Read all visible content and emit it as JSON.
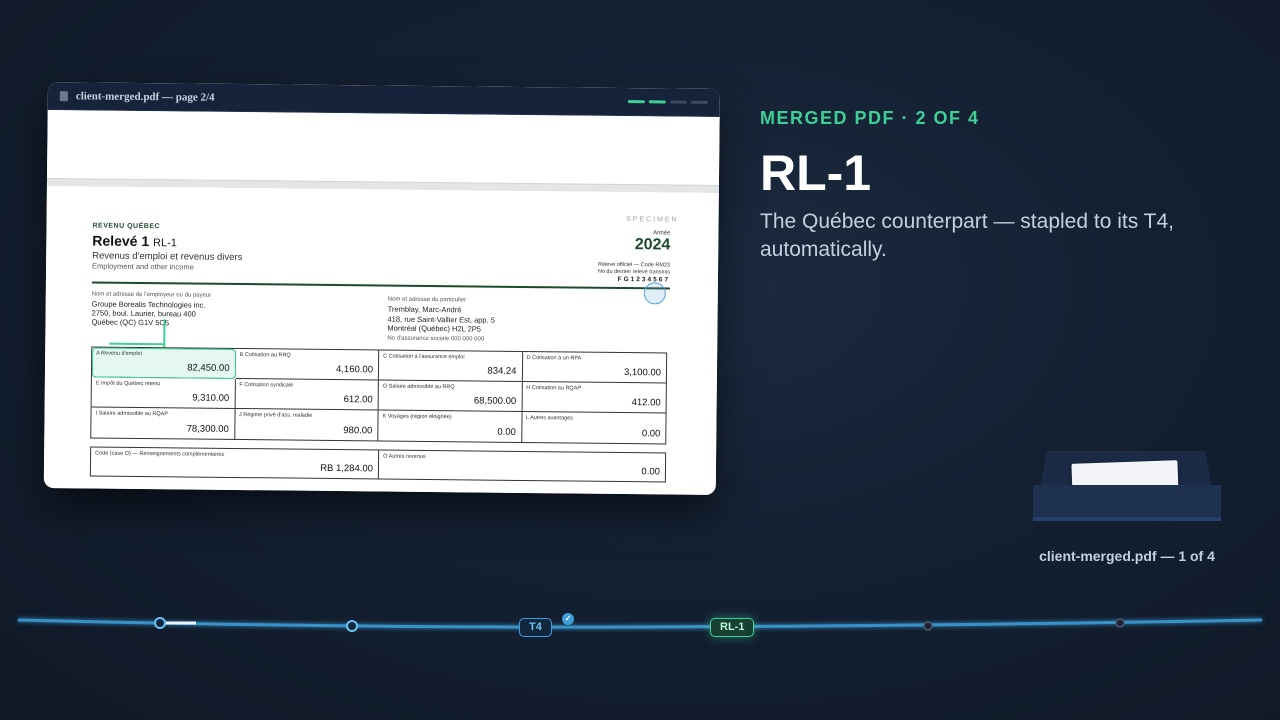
{
  "pdf_window": {
    "title": "client-merged.pdf — page 2/4",
    "pages_total": 4,
    "pages_done": 2
  },
  "form": {
    "specimen": "SPECIMEN",
    "issuer": "REVENU QUÉBEC",
    "title": "Relevé 1",
    "title_code": "RL-1",
    "desc_fr": "Revenus d'emploi et revenus divers",
    "desc_en": "Employment and other income",
    "year_label": "Année",
    "year": "2024",
    "official_1": "Relevé officiel — Code RM23",
    "official_2": "No du dernier relevé transmis",
    "official_3": "FG1234567",
    "employer_label": "Nom et adresse de l'employeur ou du payeur",
    "employer_name": "Groupe Borealis Technologies inc.",
    "employer_addr1": "2750, boul. Laurier, bureau 400",
    "employer_addr2": "Québec (QC) G1V 5C5",
    "individual_label": "Nom et adresse du particulier",
    "individual_name": "Tremblay, Marc-André",
    "individual_addr1": "418, rue Saint-Vallier Est, app. 5",
    "individual_addr2": "Montréal (Québec) H2L 2P5",
    "sin_line": "No d'assurance sociale   000 000 000",
    "boxes": [
      {
        "label": "A Revenu d'emploi",
        "value": "82,450.00"
      },
      {
        "label": "B Cotisation au RRQ",
        "value": "4,160.00"
      },
      {
        "label": "C Cotisation à l'assurance emploi",
        "value": "834.24"
      },
      {
        "label": "D Cotisation à un RPA",
        "value": "3,100.00"
      },
      {
        "label": "E Impôt du Québec retenu",
        "value": "9,310.00"
      },
      {
        "label": "F Cotisation syndicale",
        "value": "612.00"
      },
      {
        "label": "G Salaire admissible au RRQ",
        "value": "68,500.00"
      },
      {
        "label": "H Cotisation au RQAP",
        "value": "412.00"
      },
      {
        "label": "I Salaire admissible au RQAP",
        "value": "78,300.00"
      },
      {
        "label": "J Régime privé d'ass. maladie",
        "value": "980.00"
      },
      {
        "label": "K Voyages (région éloignée)",
        "value": "0.00"
      },
      {
        "label": "L Autres avantages",
        "value": "0.00"
      }
    ],
    "extra_boxes": [
      {
        "label": "Code (case O) — Renseignements complémentaires",
        "value": "RB   1,284.00"
      },
      {
        "label": "O Autres revenus",
        "value": "0.00"
      }
    ]
  },
  "panel": {
    "eyebrow": "MERGED PDF · 2 OF 4",
    "headline": "RL-1",
    "subtitle": "The Québec counterpart — stapled to its T4, automatically."
  },
  "tray": {
    "label": "client-merged.pdf — 1 of 4"
  },
  "timeline": {
    "nodes": [
      "",
      "",
      "T4",
      "RL-1",
      "",
      ""
    ],
    "t4_label": "T4",
    "rl1_label": "RL-1",
    "accent": "#3ecf96",
    "line_color": "#3e9fd8"
  }
}
